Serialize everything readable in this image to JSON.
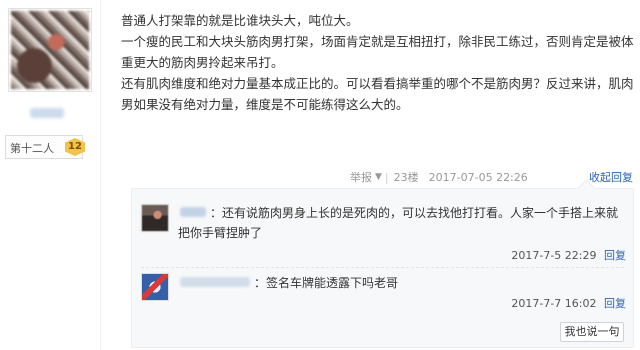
{
  "user": {
    "level_name": "第十二人",
    "level_number": "12"
  },
  "post": {
    "paragraphs": [
      "普通人打架靠的就是比谁块头大，吨位大。",
      "一个瘦的民工和大块头筋肉男打架，场面肯定就是互相扭打，除非民工练过，否则肯定是被体重更大的筋肉男拎起来吊打。",
      "还有肌肉维度和绝对力量基本成正比的。可以看看搞举重的哪个不是筋肉男？反过来讲，肌肉男如果没有绝对力量，维度是不可能练得这么大的。"
    ],
    "meta": {
      "report": "举报",
      "floor": "23楼",
      "time": "2017-07-05 22:26",
      "collapse": "收起回复"
    }
  },
  "replies": [
    {
      "text": "：还有说筋肉男身上长的是死肉的，可以去找他打打看。人家一个手搭上来就把你手臂捏肿了",
      "time": "2017-7-5 22:29",
      "reply_label": "回复"
    },
    {
      "text": "：签名车牌能透露下吗老哥",
      "time": "2017-7-7 16:02",
      "reply_label": "回复"
    }
  ],
  "reply_button": "我也说一句",
  "icons": {
    "dropdown": "caret-down-icon"
  },
  "colors": {
    "link": "#2d64b3",
    "meta_gray": "#999999",
    "reply_bg": "#f7f8fa",
    "badge": "#f3c24a"
  }
}
